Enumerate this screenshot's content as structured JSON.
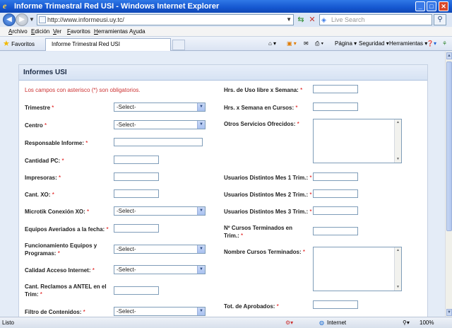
{
  "window": {
    "title": "Informe Trimestral Red USI - Windows Internet Explorer",
    "controls": {
      "minimize": "_",
      "maximize": "□",
      "close": "✕"
    }
  },
  "addressbar": {
    "url": "http://www.informeusi.uy.tc/",
    "search_placeholder": "Live Search"
  },
  "menu": [
    "Archivo",
    "Edición",
    "Ver",
    "Favoritos",
    "Herramientas",
    "Ayuda"
  ],
  "menu_hotkeys": [
    "A",
    "E",
    "V",
    "F",
    "H",
    "y"
  ],
  "favorites_label": "Favoritos",
  "tab_title": "Informe Trimestral Red USI",
  "commandbar": {
    "pagina": "Página",
    "seguridad": "Seguridad",
    "herramientas": "Herramientas"
  },
  "form": {
    "panel_title": "Informes USI",
    "required_note": "Los campos con asterisco (*) son obligatorios.",
    "select_default": "-Select-",
    "left_fields": {
      "trimestre": "Trimestre",
      "centro": "Centro",
      "responsable": "Responsable Informe:",
      "cantidad_pc": "Cantidad PC:",
      "impresoras": "Impresoras:",
      "cant_xo": "Cant. XO:",
      "microtik": "Microtik Conexión XO:",
      "equipos_averiados": "Equipos Averiados a la fecha:",
      "funcionamiento_1": "Funcionamiento Equipos y",
      "funcionamiento_2": "Programas:",
      "calidad": "Calidad Acceso Internet:",
      "reclamos_1": "Cant. Reclamos a ANTEL en el",
      "reclamos_2": "Trim:",
      "filtro": "Filtro de Contenidos:"
    },
    "right_fields": {
      "hrs_libre": "Hrs. de Uso libre x Semana:",
      "hrs_cursos": "Hrs. x Semana en Cursos:",
      "otros_servicios": "Otros Servicios Ofrecidos:",
      "usuarios_mes1": "Usuarios Distintos Mes 1 Trim.:",
      "usuarios_mes2": "Usuarios Distintos Mes 2 Trim.:",
      "usuarios_mes3": "Usuarios Distintos Mes 3 Trim.:",
      "cursos_terminados_1": "Nº Cursos Terminados en",
      "cursos_terminados_2": "Trim.:",
      "nombre_cursos": "Nombre Cursos Terminados:",
      "tot_aprobados": "Tot. de Aprobados:"
    },
    "asterisk": "*"
  },
  "status": {
    "left": "Listo",
    "zone": "Internet",
    "zoom": "100%"
  }
}
